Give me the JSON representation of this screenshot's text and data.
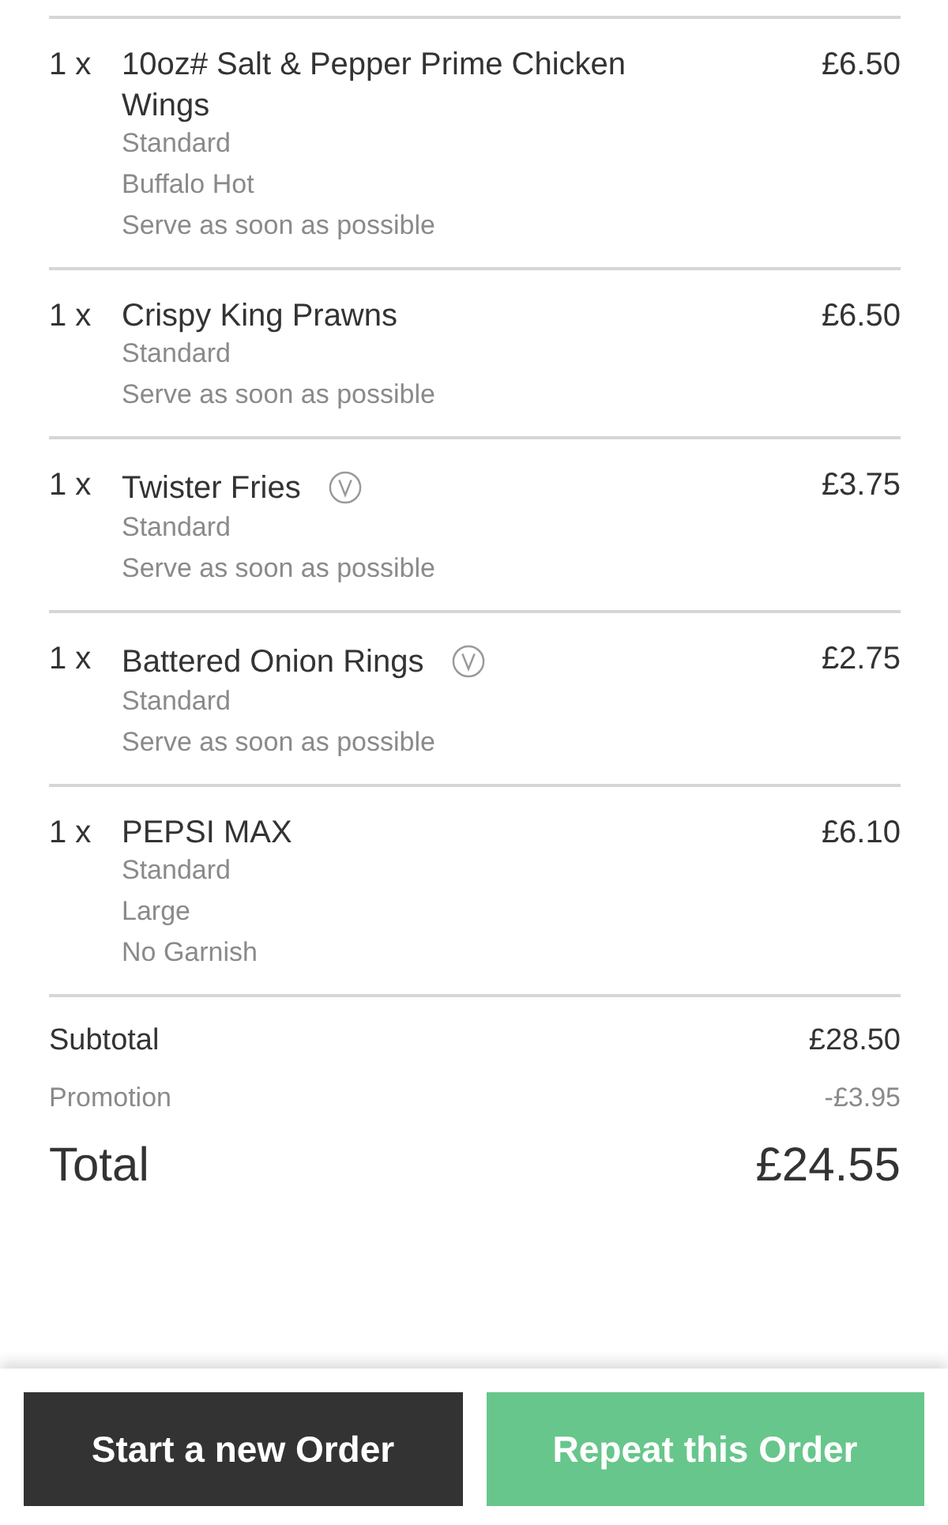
{
  "items": [
    {
      "quantity": "1 x",
      "name": "10oz# Salt & Pepper Prime Chicken Wings",
      "vegetarian": false,
      "options": [
        "Standard",
        "Buffalo Hot",
        "Serve as soon as possible"
      ],
      "price": "£6.50"
    },
    {
      "quantity": "1 x",
      "name": "Crispy King Prawns",
      "vegetarian": false,
      "options": [
        "Standard",
        "Serve as soon as possible"
      ],
      "price": "£6.50"
    },
    {
      "quantity": "1 x",
      "name": "Twister Fries",
      "vegetarian": true,
      "options": [
        "Standard",
        "Serve as soon as possible"
      ],
      "price": "£3.75"
    },
    {
      "quantity": "1 x",
      "name": "Battered Onion Rings",
      "vegetarian": true,
      "options": [
        "Standard",
        "Serve as soon as possible"
      ],
      "price": "£2.75"
    },
    {
      "quantity": "1 x",
      "name": "PEPSI MAX",
      "vegetarian": false,
      "options": [
        "Standard",
        "Large",
        "No Garnish"
      ],
      "price": "£6.10"
    }
  ],
  "summary": [
    {
      "kind": "subtotal",
      "label": "Subtotal",
      "value": "£28.50"
    },
    {
      "kind": "promotion",
      "label": "Promotion",
      "value": "-£3.95"
    },
    {
      "kind": "total",
      "label": "Total",
      "value": "£24.55"
    }
  ],
  "buttons": [
    {
      "kind": "dark",
      "label": "Start a new Order"
    },
    {
      "kind": "green",
      "label": "Repeat this Order"
    }
  ]
}
